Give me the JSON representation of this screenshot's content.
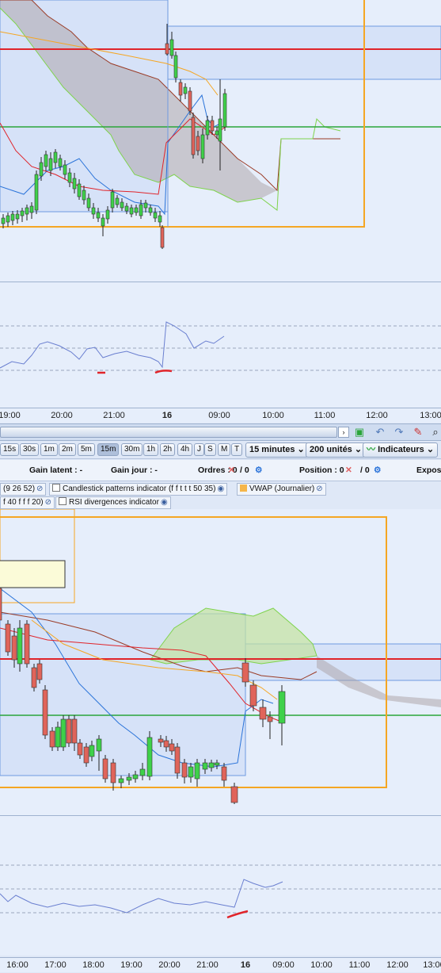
{
  "top_chart": {
    "time_axis": [
      {
        "label": "19:00",
        "bold": false
      },
      {
        "label": "20:00",
        "bold": false
      },
      {
        "label": "21:00",
        "bold": false
      },
      {
        "label": "16",
        "bold": true
      },
      {
        "label": "09:00",
        "bold": false
      },
      {
        "label": "10:00",
        "bold": false
      },
      {
        "label": "11:00",
        "bold": false
      },
      {
        "label": "12:00",
        "bold": false
      },
      {
        "label": "13:00",
        "bold": false
      }
    ]
  },
  "scrollbar": {
    "arrow": "›"
  },
  "toolbar": {
    "icons": [
      "chart-settings-icon",
      "undo-icon",
      "redo-icon",
      "draw-tools-icon",
      "zoom-icon"
    ],
    "timeframes": [
      {
        "label": "15s",
        "selected": false
      },
      {
        "label": "30s",
        "selected": false
      },
      {
        "label": "1m",
        "selected": false
      },
      {
        "label": "2m",
        "selected": false
      },
      {
        "label": "5m",
        "selected": false
      },
      {
        "label": "15m",
        "selected": true
      },
      {
        "label": "30m",
        "selected": false
      },
      {
        "label": "1h",
        "selected": false
      },
      {
        "label": "2h",
        "selected": false
      },
      {
        "label": "4h",
        "selected": false
      },
      {
        "label": "J",
        "selected": false
      },
      {
        "label": "S",
        "selected": false
      },
      {
        "label": "M",
        "selected": false
      },
      {
        "label": "T",
        "selected": false
      }
    ],
    "interval_select": "15 minutes",
    "units_select": "200 unités",
    "indicators_button": "Indicateurs"
  },
  "status": {
    "gain_latent": "Gain latent : -",
    "gain_jour": "Gain jour : -",
    "ordres_label": "Ordres : 0",
    "ordres_slash": "/ 0",
    "position_label": "Position : 0",
    "position_slash": "/ 0",
    "exposure": "Expos"
  },
  "indicator_tags": {
    "row1": {
      "ichimoku": "(9 26 52)",
      "candlestick": "Candlestick patterns indicator (f f t t t 50 35)",
      "vwap": "VWAP (Journalier)"
    },
    "row2": {
      "rsi_params": "f 40 f f f 20)",
      "rsi_div": "RSI divergences indicator"
    }
  },
  "bottom_chart": {
    "time_axis": [
      {
        "label": "16:00",
        "bold": false
      },
      {
        "label": "17:00",
        "bold": false
      },
      {
        "label": "18:00",
        "bold": false
      },
      {
        "label": "19:00",
        "bold": false
      },
      {
        "label": "20:00",
        "bold": false
      },
      {
        "label": "21:00",
        "bold": false
      },
      {
        "label": "16",
        "bold": true
      },
      {
        "label": "09:00",
        "bold": false
      },
      {
        "label": "10:00",
        "bold": false
      },
      {
        "label": "11:00",
        "bold": false
      },
      {
        "label": "12:00",
        "bold": false
      },
      {
        "label": "13:00",
        "bold": false
      }
    ]
  },
  "colors": {
    "background": "#e6eefb",
    "bull": "#3fd14a",
    "bear": "#e0645a",
    "resistance": "#e0242a",
    "support": "#2aa53a",
    "vwap_box": "#f5a623",
    "tenkan": "#2a73d9",
    "rsi_line": "#6a7fd0",
    "cloud": "#a99fa4"
  }
}
